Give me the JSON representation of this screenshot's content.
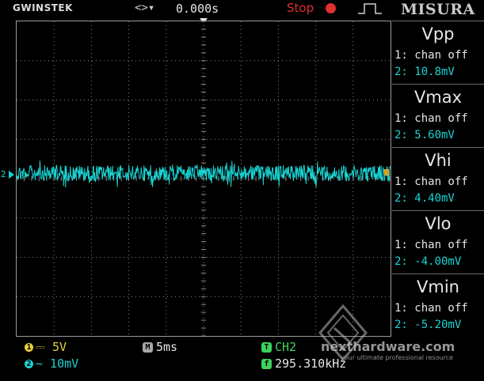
{
  "header": {
    "brand": "GWINSTEK",
    "trigger_icons": "<>▾",
    "trigger_time": "0.000s",
    "run_state": "Stop",
    "watermark": "MISURA"
  },
  "colors": {
    "ch1": "#e8d23a",
    "ch2": "#19d3d3",
    "stop": "#e03030",
    "trigger": "#3fd35a",
    "grid": "#8a8a8a"
  },
  "markers": {
    "ch2_label": "2"
  },
  "measurements": [
    {
      "title": "Vpp",
      "ch1": "1: chan off",
      "ch2": "2: 10.8mV"
    },
    {
      "title": "Vmax",
      "ch1": "1: chan off",
      "ch2": "2: 5.60mV"
    },
    {
      "title": "Vhi",
      "ch1": "1: chan off",
      "ch2": "2: 4.40mV"
    },
    {
      "title": "Vlo",
      "ch1": "1: chan off",
      "ch2": "2: -4.00mV"
    },
    {
      "title": "Vmin",
      "ch1": "1: chan off",
      "ch2": "2: -5.20mV"
    }
  ],
  "footer": {
    "ch1_num": "1",
    "ch1_coupling_value": "⎓ 5V",
    "ch2_num": "2",
    "ch2_coupling_value": "~ 10mV",
    "timebase_badge": "M",
    "timebase": "5ms",
    "trigger_badge": "T",
    "trigger_source": "CH2",
    "freq_badge": "f",
    "frequency": "295.310kHz",
    "watermark_name": "nexthardware.com",
    "watermark_tagline": "your ultimate professional resource"
  }
}
